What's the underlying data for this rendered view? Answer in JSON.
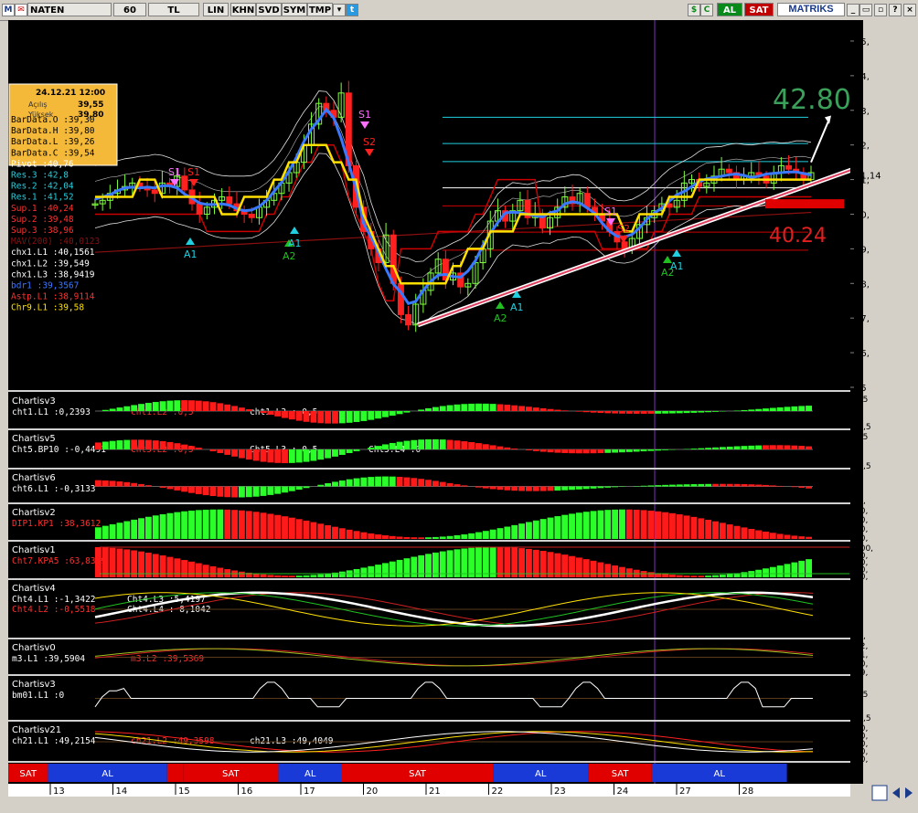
{
  "toolbar": {
    "symbol": "NATEN",
    "period": "60",
    "currency": "TL",
    "scale": "LIN",
    "buttons": [
      "KHN",
      "SVD",
      "SYM",
      "TMP"
    ],
    "al_label": "AL",
    "sat_label": "SAT",
    "brand": "MATRIKS",
    "icons": [
      "m-logo-icon",
      "flag-icon",
      "dropdown-icon",
      "twitter-icon",
      "dollar-icon",
      "refresh-icon",
      "minimize-icon",
      "print-icon",
      "help-icon",
      "close-icon"
    ]
  },
  "colors": {
    "bull": "#7fff3f",
    "bear": "#ff2020",
    "yellow": "#ffe000",
    "blue": "#3a78ff",
    "red": "#cc0000",
    "green": "#20c020",
    "cyan": "#20d0e0",
    "pink": "#ff70ff",
    "al_blue": "#1a3ad8",
    "sat_red": "#e00000"
  },
  "info_box": {
    "date": "24.12.21 12:00",
    "rows": [
      {
        "label": "Açılış",
        "value": "39,55"
      },
      {
        "label": "Yüksek",
        "value": "39,80"
      }
    ]
  },
  "legend": [
    {
      "text": "BarData.O :39,30",
      "color": "#000"
    },
    {
      "text": "BarData.H :39,80",
      "color": "#000"
    },
    {
      "text": "BarData.L :39,26",
      "color": "#000"
    },
    {
      "text": "BarData.C :39,54",
      "color": "#000"
    },
    {
      "text": "Pivot     :40,76",
      "color": "#fff"
    },
    {
      "text": "Res.3     :42,8",
      "color": "#20d0e0"
    },
    {
      "text": "Res.2     :42,04",
      "color": "#20d0e0"
    },
    {
      "text": "Res.1     :41,52",
      "color": "#20d0e0"
    },
    {
      "text": "Sup.1     :40,24",
      "color": "#ff3030"
    },
    {
      "text": "Sup.2     :39,48",
      "color": "#ff3030"
    },
    {
      "text": "Sup.3     :38,96",
      "color": "#ff3030"
    },
    {
      "text": "MAV(200)  :40,0123",
      "color": "#8a1010"
    },
    {
      "text": "chx1.L1   :40,1561",
      "color": "#fff"
    },
    {
      "text": "chx1.L2   :39,549",
      "color": "#fff"
    },
    {
      "text": "chx1.L3   :38,9419",
      "color": "#fff"
    },
    {
      "text": "bdr1      :39,3567",
      "color": "#3a78ff"
    },
    {
      "text": "Astp.L1   :38,9114",
      "color": "#ff3030"
    },
    {
      "text": "Chr9.L1   :39,58",
      "color": "#ffe000"
    }
  ],
  "main_chart": {
    "y_ticks": [
      "45,",
      "44,",
      "43,",
      "42,",
      "41,",
      "40,",
      "39,",
      "38,",
      "37,",
      "36,",
      "35"
    ],
    "last_price": "41,14",
    "target_label": "42.80",
    "support_label": "40.24",
    "signal_labels": [
      "S1",
      "S1",
      "A1",
      "A2",
      "A1",
      "S1",
      "S2",
      "A2",
      "A1",
      "S1",
      "S2",
      "A2",
      "A1"
    ],
    "close": [
      40.3,
      40.4,
      40.6,
      40.7,
      40.8,
      40.9,
      40.8,
      40.7,
      40.6,
      40.9,
      40.8,
      41.1,
      40.7,
      40.3,
      40.0,
      40.2,
      40.4,
      40.5,
      40.3,
      40.1,
      40.0,
      39.9,
      40.2,
      40.4,
      40.6,
      40.9,
      41.2,
      41.5,
      42.0,
      42.6,
      43.2,
      43.0,
      42.8,
      43.5,
      41.4,
      40.2,
      39.5,
      39.0,
      38.6,
      39.4,
      38.0,
      37.1,
      36.8,
      37.4,
      37.8,
      38.3,
      38.7,
      38.1,
      38.3,
      37.9,
      38.0,
      38.6,
      39.0,
      39.8,
      40.1,
      39.8,
      40.1,
      40.4,
      39.9,
      40.0,
      39.6,
      39.9,
      40.2,
      40.5,
      40.3,
      40.6,
      40.2,
      40.0,
      39.8,
      39.5,
      39.2,
      39.0,
      39.3,
      39.7,
      39.9,
      40.1,
      40.3,
      40.2,
      40.4,
      40.9,
      41.0,
      40.8,
      40.9,
      41.1,
      41.3,
      41.2,
      41.0,
      41.1,
      41.2,
      41.1,
      40.9,
      41.2,
      41.4,
      41.3,
      41.2,
      41.0,
      41.2
    ]
  },
  "panels": [
    {
      "title": "Chartisv3",
      "legends": [
        "cht1.L1 :0,2393",
        "cht1.L2 :0,5",
        "cht1.L3 :-0,5"
      ],
      "ticks": [
        "0,5",
        "0",
        "-0,5"
      ],
      "type": "hist"
    },
    {
      "title": "Chartisv5",
      "legends": [
        "Cht5.BP10 :-0,4491",
        "Cht5.L2 :0,5",
        "Cht5.L3 :-0,5",
        "Cht5.L4 :0"
      ],
      "ticks": [
        "0,5",
        "0",
        "-0,5"
      ],
      "type": "hist"
    },
    {
      "title": "Chartisv6",
      "legends": [
        "cht6.L1 :-0,3133"
      ],
      "ticks": [
        "2,",
        "0",
        "-2,"
      ],
      "type": "hist"
    },
    {
      "title": "Chartisv2",
      "legends": [
        "DIP1.KP1 :38,3612"
      ],
      "ticks": [
        "80,",
        "60,",
        "40,",
        "20,"
      ],
      "type": "bar"
    },
    {
      "title": "Chartisv1",
      "legends": [
        "Cht7.KPA5 :63,8349"
      ],
      "ticks": [
        "100,",
        "80,",
        "60,",
        "40,",
        "20,"
      ],
      "type": "bar"
    },
    {
      "title": "Chartisv4",
      "legends": [
        "Cht4.L1 :-1,3422",
        "Cht4.L2 :-0,5518",
        "Cht4.L3 :5,4197",
        "Cht4.L4 :-8,1042"
      ],
      "ticks": [
        "5,",
        "0",
        "-5,"
      ],
      "type": "lines"
    },
    {
      "title": "Chartisv0",
      "legends": [
        "m3.L1 :39,5904",
        "m3.L2 :39,5369"
      ],
      "ticks": [
        "42,",
        "41,",
        "40,",
        "39,"
      ],
      "type": "lines2"
    },
    {
      "title": "Chartisv3",
      "legends": [
        "bm01.L1 :0"
      ],
      "ticks": [
        "1,",
        "0,5",
        "0",
        "-0,5"
      ],
      "type": "osc"
    },
    {
      "title": "Chartisv21",
      "legends": [
        "ch21.L1 :49,2154",
        "ch21.L2 :49,3598",
        "ch21.L3 :49,4049"
      ],
      "ticks": [
        "70,",
        "60,",
        "50,",
        "40,",
        "30,"
      ],
      "type": "lines3"
    }
  ],
  "signal_strip": [
    {
      "label": "SAT",
      "span": [
        0,
        0.05
      ]
    },
    {
      "label": "AL",
      "span": [
        0.05,
        0.2
      ]
    },
    {
      "label": "",
      "span": [
        0.2,
        0.22
      ]
    },
    {
      "label": "SAT",
      "span": [
        0.22,
        0.34
      ]
    },
    {
      "label": "AL",
      "span": [
        0.34,
        0.42
      ]
    },
    {
      "label": "SAT",
      "span": [
        0.42,
        0.61
      ]
    },
    {
      "label": "AL",
      "span": [
        0.61,
        0.73
      ]
    },
    {
      "label": "SAT",
      "span": [
        0.73,
        0.81
      ]
    },
    {
      "label": "AL",
      "span": [
        0.81,
        0.98
      ]
    }
  ],
  "x_ticks": [
    "13",
    "14",
    "15",
    "16",
    "17",
    "20",
    "21",
    "22",
    "23",
    "24",
    "27",
    "28"
  ]
}
